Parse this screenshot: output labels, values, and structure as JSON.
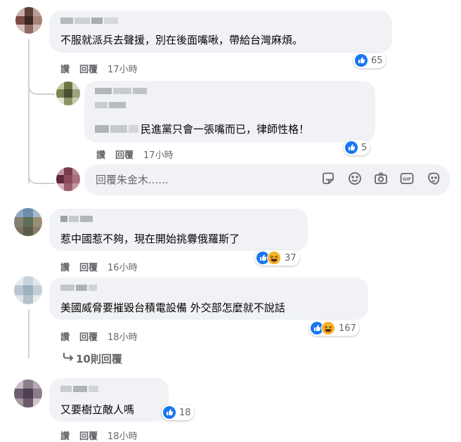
{
  "comments": [
    {
      "text": "不服就派兵去聲援，別在後面嘴啾，帶給台灣麻煩。",
      "actions": {
        "like": "讚",
        "reply": "回覆",
        "time": "17小時"
      },
      "reaction_count": "65",
      "reactions": [
        "like"
      ]
    },
    {
      "text": "民進黨只會一張嘴而已，律師性格！",
      "actions": {
        "like": "讚",
        "reply": "回覆",
        "time": "17小時"
      },
      "reaction_count": "5",
      "reactions": [
        "like"
      ]
    },
    {
      "text": "惹中國惹不夠，現在開始挑釁俄羅斯了",
      "actions": {
        "like": "讚",
        "reply": "回覆",
        "time": "16小時"
      },
      "reaction_count": "37",
      "reactions": [
        "like",
        "haha"
      ]
    },
    {
      "text": "美國威脅要摧毀台積電設備 外交部怎麼就不說話",
      "actions": {
        "like": "讚",
        "reply": "回覆",
        "time": "18小時"
      },
      "reaction_count": "167",
      "reactions": [
        "like",
        "haha"
      ],
      "more_replies": "10則回覆"
    },
    {
      "text": "又要樹立敵人嗎",
      "actions": {
        "like": "讚",
        "reply": "回覆",
        "time": "18小時"
      },
      "reaction_count": "18",
      "reactions": [
        "like"
      ]
    }
  ],
  "reply_input": {
    "placeholder": "回覆朱金木......"
  },
  "composer_tools": [
    "sticker-icon",
    "emoji-icon",
    "camera-icon",
    "gif-icon",
    "avatar-sticker-icon"
  ],
  "colors": {
    "bubble": "#f0f2f5",
    "like_blue": "#1877f2",
    "haha_yellow": "#f7b125",
    "meta_gray": "#65676b"
  }
}
